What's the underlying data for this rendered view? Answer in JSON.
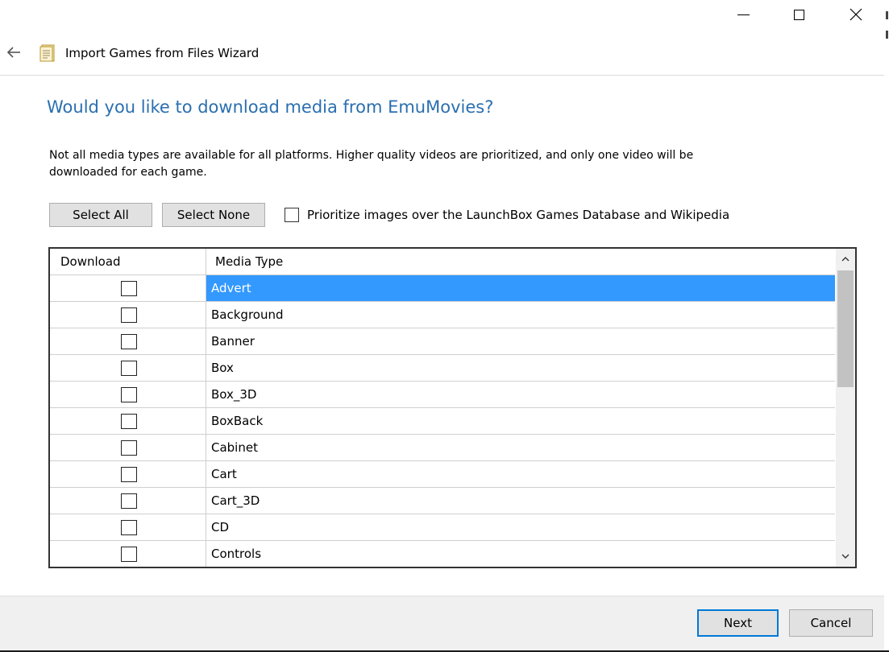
{
  "window": {
    "title": "Import Games from Files Wizard"
  },
  "page": {
    "heading": "Would you like to download media from EmuMovies?",
    "description": "Not all media types are available for all platforms. Higher quality videos are prioritized, and only one video will be downloaded for each game."
  },
  "toolbar": {
    "select_all_label": "Select All",
    "select_none_label": "Select None",
    "prioritize_label": "Prioritize images over the LaunchBox Games Database and Wikipedia",
    "prioritize_checked": false
  },
  "grid": {
    "columns": [
      "Download",
      "Media Type"
    ],
    "rows": [
      {
        "media_type": "Advert",
        "checked": false,
        "selected": true
      },
      {
        "media_type": "Background",
        "checked": false,
        "selected": false
      },
      {
        "media_type": "Banner",
        "checked": false,
        "selected": false
      },
      {
        "media_type": "Box",
        "checked": false,
        "selected": false
      },
      {
        "media_type": "Box_3D",
        "checked": false,
        "selected": false
      },
      {
        "media_type": "BoxBack",
        "checked": false,
        "selected": false
      },
      {
        "media_type": "Cabinet",
        "checked": false,
        "selected": false
      },
      {
        "media_type": "Cart",
        "checked": false,
        "selected": false
      },
      {
        "media_type": "Cart_3D",
        "checked": false,
        "selected": false
      },
      {
        "media_type": "CD",
        "checked": false,
        "selected": false
      },
      {
        "media_type": "Controls",
        "checked": false,
        "selected": false
      }
    ]
  },
  "footer": {
    "next_label": "Next",
    "cancel_label": "Cancel"
  },
  "colors": {
    "heading": "#2a6fb0",
    "selection": "#3399ff",
    "default_button_border": "#0078d7"
  },
  "icons": {
    "back": "back-arrow-icon",
    "wizard": "document-icon",
    "minimize": "minimize-icon",
    "maximize": "maximize-icon",
    "close": "close-icon",
    "scroll_up": "chevron-up-icon",
    "scroll_down": "chevron-down-icon"
  }
}
